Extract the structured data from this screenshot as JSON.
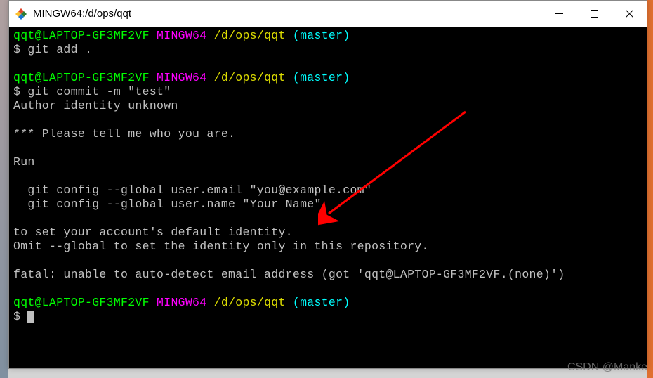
{
  "window": {
    "title": "MINGW64:/d/ops/qqt"
  },
  "prompt": {
    "user_host": "qqt@LAPTOP-GF3MF2VF",
    "system": "MINGW64",
    "path": "/d/ops/qqt",
    "branch": "(master)",
    "symbol": "$"
  },
  "cmd": {
    "add": "git add .",
    "commit": "git commit -m \"test\"",
    "empty": ""
  },
  "out": {
    "l1": "Author identity unknown",
    "l2": "",
    "l3": "*** Please tell me who you are.",
    "l4": "",
    "l5": "Run",
    "l6": "",
    "l7": "  git config --global user.email \"you@example.com\"",
    "l8": "  git config --global user.name \"Your Name\"",
    "l9": "",
    "l10": "to set your account's default identity.",
    "l11": "Omit --global to set the identity only in this repository.",
    "l12": "",
    "l13": "fatal: unable to auto-detect email address (got 'qqt@LAPTOP-GF3MF2VF.(none)')",
    "l14": ""
  },
  "watermark": "CSDN @Manke"
}
